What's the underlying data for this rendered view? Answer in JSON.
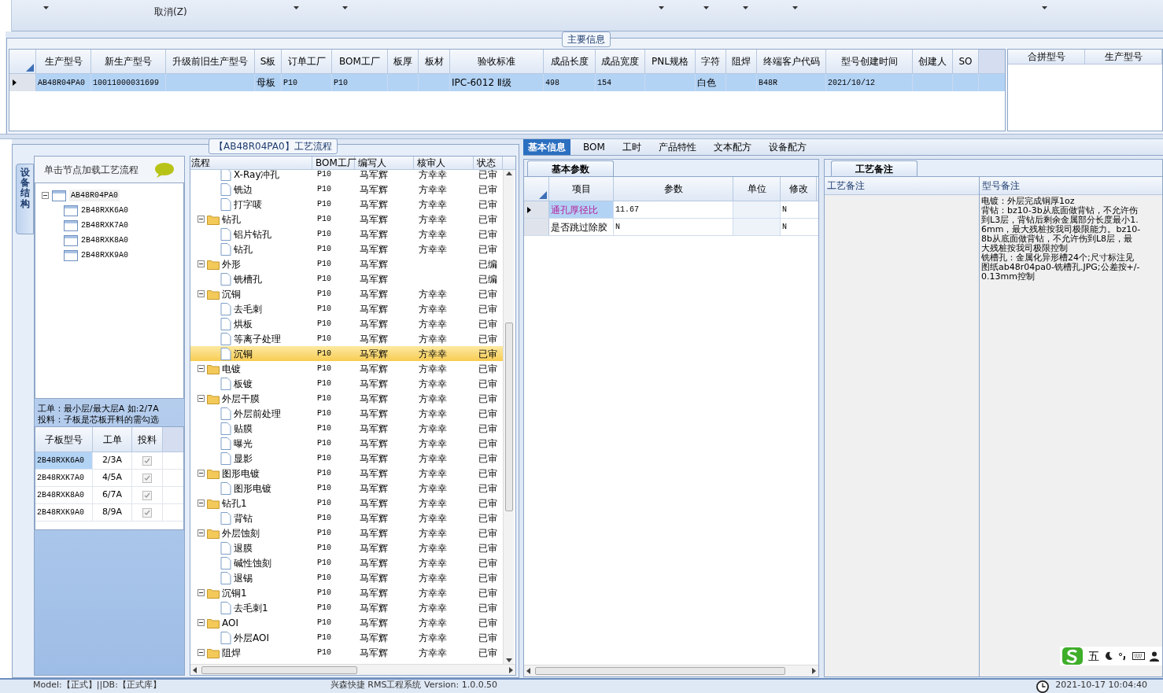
{
  "toolbar": {
    "menu_item": "取消(Z)"
  },
  "main_info": {
    "title": "主要信息",
    "columns": [
      "生产型号",
      "新生产型号",
      "升级前旧生产型号",
      "S板",
      "订单工厂",
      "BOM工厂",
      "板厚",
      "板材",
      "验收标准",
      "成品长度",
      "成品宽度",
      "PNL规格",
      "字符",
      "阻焊",
      "终端客户代码",
      "型号创建时间",
      "创建人",
      "SO"
    ],
    "rows": [
      {
        "selected": true,
        "cells": [
          "AB48R04PA0",
          "10011000031699",
          null,
          "母板",
          "P10",
          "P10",
          null,
          null,
          "IPC-6012 Ⅱ级",
          "498",
          "154",
          null,
          "白色",
          null,
          "B48R",
          "2021/10/12",
          null,
          null
        ]
      }
    ]
  },
  "merge_table": {
    "columns": [
      "合拼型号",
      "生产型号"
    ]
  },
  "process_panel": {
    "title": "【AB48R04PA0】工艺流程",
    "side_tab": "设备结构",
    "structure": {
      "hint": "单击节点加载工艺流程",
      "tree": [
        {
          "name": "AB48R04PA0",
          "expanded": true,
          "children": [
            {
              "name": "2B48RXK6A0"
            },
            {
              "name": "2B48RXK7A0"
            },
            {
              "name": "2B48RXK8A0"
            },
            {
              "name": "2B48RXK9A0"
            }
          ]
        }
      ]
    },
    "note_lines": [
      "工单：最小层/最大层A 如:2/7A",
      "投料：子板是芯板开料的需勾选"
    ],
    "sub_boards": {
      "columns": [
        "子板型号",
        "工单",
        "投料"
      ],
      "rows": [
        {
          "model": "2B48RXK6A0",
          "order": "2/3A",
          "checked": true,
          "selected": true
        },
        {
          "model": "2B48RXK7A0",
          "order": "4/5A",
          "checked": true,
          "selected": false
        },
        {
          "model": "2B48RXK8A0",
          "order": "6/7A",
          "checked": true,
          "selected": false
        },
        {
          "model": "2B48RXK9A0",
          "order": "8/9A",
          "checked": true,
          "selected": false
        }
      ]
    },
    "flow": {
      "columns": [
        "流程",
        "BOM工厂",
        "编写人",
        "核审人",
        "状态"
      ],
      "tree": [
        {
          "kind": "continued",
          "children": [
            {
              "kind": "leaf",
              "name": "X-Ray冲孔",
              "bom": "P10",
              "writer": "马军辉",
              "reviewer": "方幸幸",
              "status": "已审",
              "selected": false
            },
            {
              "kind": "leaf",
              "name": "铣边",
              "bom": "P10",
              "writer": "马军辉",
              "reviewer": "方幸幸",
              "status": "已审",
              "selected": false
            },
            {
              "kind": "leaf",
              "name": "打字唛",
              "bom": "P10",
              "writer": "马军辉",
              "reviewer": "方幸幸",
              "status": "已审",
              "selected": false
            }
          ]
        },
        {
          "kind": "folder",
          "name": "钻孔",
          "bom": "P10",
          "writer": "马军辉",
          "reviewer": "方幸幸",
          "status": "已审",
          "selected": false,
          "expanded": true,
          "children": [
            {
              "kind": "leaf",
              "name": "铝片钻孔",
              "bom": "P10",
              "writer": "马军辉",
              "reviewer": "方幸幸",
              "status": "已审",
              "selected": false
            },
            {
              "kind": "leaf",
              "name": "钻孔",
              "bom": "P10",
              "writer": "马军辉",
              "reviewer": "方幸幸",
              "status": "已审",
              "selected": false
            }
          ]
        },
        {
          "kind": "folder",
          "name": "外形",
          "bom": "P10",
          "writer": "马军辉",
          "status": "已编",
          "selected": false,
          "expanded": true,
          "children": [
            {
              "kind": "leaf",
              "name": "铣槽孔",
              "bom": "P10",
              "writer": "马军辉",
              "status": "已编",
              "selected": false
            }
          ]
        },
        {
          "kind": "folder",
          "name": "沉铜",
          "bom": "P10",
          "writer": "马军辉",
          "reviewer": "方幸幸",
          "status": "已审",
          "selected": false,
          "expanded": true,
          "children": [
            {
              "kind": "leaf",
              "name": "去毛刺",
              "bom": "P10",
              "writer": "马军辉",
              "reviewer": "方幸幸",
              "status": "已审",
              "selected": false
            },
            {
              "kind": "leaf",
              "name": "烘板",
              "bom": "P10",
              "writer": "马军辉",
              "reviewer": "方幸幸",
              "status": "已审",
              "selected": false
            },
            {
              "kind": "leaf",
              "name": "等离子处理",
              "bom": "P10",
              "writer": "马军辉",
              "reviewer": "方幸幸",
              "status": "已审",
              "selected": false
            },
            {
              "kind": "leaf",
              "name": "沉铜",
              "bom": "P10",
              "writer": "马军辉",
              "reviewer": "方幸幸",
              "status": "已审",
              "selected": true
            }
          ]
        },
        {
          "kind": "folder",
          "name": "电镀",
          "bom": "P10",
          "writer": "马军辉",
          "reviewer": "方幸幸",
          "status": "已审",
          "selected": false,
          "expanded": true,
          "children": [
            {
              "kind": "leaf",
              "name": "板镀",
              "bom": "P10",
              "writer": "马军辉",
              "reviewer": "方幸幸",
              "status": "已审",
              "selected": false
            }
          ]
        },
        {
          "kind": "folder",
          "name": "外层干膜",
          "bom": "P10",
          "writer": "马军辉",
          "reviewer": "方幸幸",
          "status": "已审",
          "selected": false,
          "expanded": true,
          "children": [
            {
              "kind": "leaf",
              "name": "外层前处理",
              "bom": "P10",
              "writer": "马军辉",
              "reviewer": "方幸幸",
              "status": "已审",
              "selected": false
            },
            {
              "kind": "leaf",
              "name": "贴膜",
              "bom": "P10",
              "writer": "马军辉",
              "reviewer": "方幸幸",
              "status": "已审",
              "selected": false
            },
            {
              "kind": "leaf",
              "name": "曝光",
              "bom": "P10",
              "writer": "马军辉",
              "reviewer": "方幸幸",
              "status": "已审",
              "selected": false
            },
            {
              "kind": "leaf",
              "name": "显影",
              "bom": "P10",
              "writer": "马军辉",
              "reviewer": "方幸幸",
              "status": "已审",
              "selected": false
            }
          ]
        },
        {
          "kind": "folder",
          "name": "图形电镀",
          "bom": "P10",
          "writer": "马军辉",
          "reviewer": "方幸幸",
          "status": "已审",
          "selected": false,
          "expanded": true,
          "children": [
            {
              "kind": "leaf",
              "name": "图形电镀",
              "bom": "P10",
              "writer": "马军辉",
              "reviewer": "方幸幸",
              "status": "已审",
              "selected": false
            }
          ]
        },
        {
          "kind": "folder",
          "name": "钻孔1",
          "bom": "P10",
          "writer": "马军辉",
          "reviewer": "方幸幸",
          "status": "已审",
          "selected": false,
          "expanded": true,
          "children": [
            {
              "kind": "leaf",
              "name": "背钻",
              "bom": "P10",
              "writer": "马军辉",
              "reviewer": "方幸幸",
              "status": "已审",
              "selected": false
            }
          ]
        },
        {
          "kind": "folder",
          "name": "外层蚀刻",
          "bom": "P10",
          "writer": "马军辉",
          "reviewer": "方幸幸",
          "status": "已审",
          "selected": false,
          "expanded": true,
          "children": [
            {
              "kind": "leaf",
              "name": "退膜",
              "bom": "P10",
              "writer": "马军辉",
              "reviewer": "方幸幸",
              "status": "已审",
              "selected": false
            },
            {
              "kind": "leaf",
              "name": "碱性蚀刻",
              "bom": "P10",
              "writer": "马军辉",
              "reviewer": "方幸幸",
              "status": "已审",
              "selected": false
            },
            {
              "kind": "leaf",
              "name": "退锡",
              "bom": "P10",
              "writer": "马军辉",
              "reviewer": "方幸幸",
              "status": "已审",
              "selected": false
            }
          ]
        },
        {
          "kind": "folder",
          "name": "沉铜1",
          "bom": "P10",
          "writer": "马军辉",
          "reviewer": "方幸幸",
          "status": "已审",
          "selected": false,
          "expanded": true,
          "children": [
            {
              "kind": "leaf",
              "name": "去毛刺1",
              "bom": "P10",
              "writer": "马军辉",
              "reviewer": "方幸幸",
              "status": "已审",
              "selected": false
            }
          ]
        },
        {
          "kind": "folder",
          "name": "AOI",
          "bom": "P10",
          "writer": "马军辉",
          "reviewer": "方幸幸",
          "status": "已审",
          "selected": false,
          "expanded": true,
          "children": [
            {
              "kind": "leaf",
              "name": "外层AOI",
              "bom": "P10",
              "writer": "马军辉",
              "reviewer": "方幸幸",
              "status": "已审",
              "selected": false
            }
          ]
        },
        {
          "kind": "folder",
          "name": "阻焊",
          "bom": "P10",
          "writer": "马军辉",
          "reviewer": "方幸幸",
          "status": "已审",
          "selected": false,
          "expanded": true
        }
      ]
    }
  },
  "detail_tabs": [
    {
      "label": "基本信息",
      "selected": true
    },
    {
      "label": "BOM",
      "selected": false
    },
    {
      "label": "工时",
      "selected": false
    },
    {
      "label": "产品特性",
      "selected": false
    },
    {
      "label": "文本配方",
      "selected": false
    },
    {
      "label": "设备配方",
      "selected": false
    }
  ],
  "basic_params": {
    "tab": "基本参数",
    "columns": [
      "项目",
      "参数",
      "单位",
      "修改"
    ],
    "rows": [
      {
        "item": "通孔厚径比",
        "value": "11.67",
        "modified": "N",
        "selected": true
      },
      {
        "item": "是否跳过除胶",
        "value": "N",
        "modified": "N",
        "selected": false
      }
    ]
  },
  "process_notes": {
    "tab": "工艺备注",
    "columns": [
      "工艺备注",
      "型号备注"
    ],
    "model_note": [
      "电镀：外层完成铜厚1oz",
      "背钻：bz10-3b从底面做背钻，不允许伤到L3层，背钻后剩余金属部分长度最小1.6mm，最大残桩按我司极限能力。bz10-8b从底面做背钻，不允许伤到L8层，最大残桩按我司极限控制",
      "铣槽孔：金属化异形槽24个;尺寸标注见图纸ab48r04pa0-铣槽孔.JPG;公差按+/-0.13mm控制"
    ]
  },
  "ime": {
    "mode": "五"
  },
  "status_bar": {
    "left": "Model:【正式】||DB:【正式库】",
    "center": "兴森快捷 RMS工程系统 Version: 1.0.0.50",
    "time": "2021-10-17 10:04:40"
  }
}
